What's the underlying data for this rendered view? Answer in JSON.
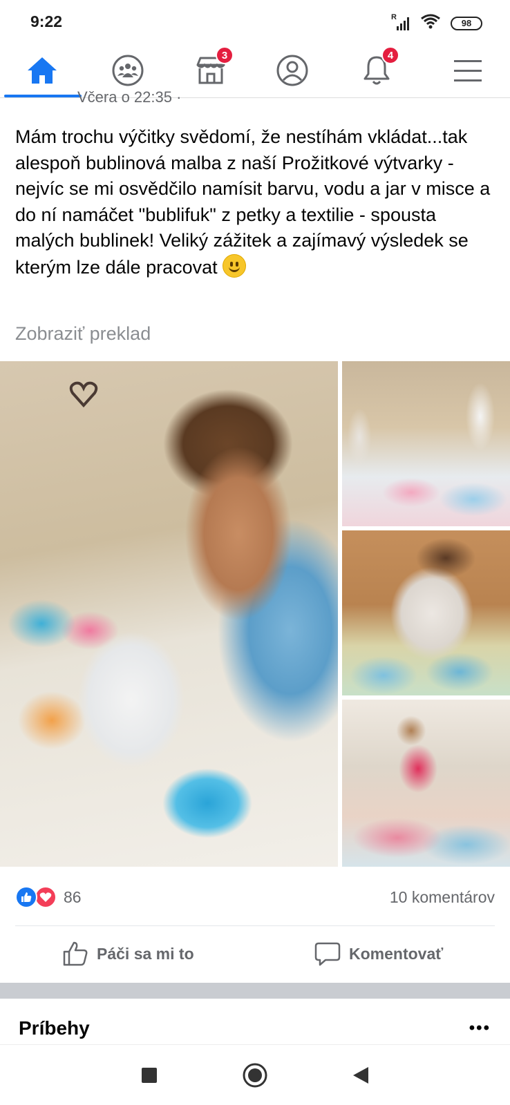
{
  "status_bar": {
    "time": "9:22",
    "signal_label": "R",
    "battery": "98"
  },
  "top_nav": {
    "items": [
      {
        "name": "home",
        "active": true
      },
      {
        "name": "groups",
        "active": false
      },
      {
        "name": "marketplace",
        "badge": "3"
      },
      {
        "name": "profile",
        "active": false
      },
      {
        "name": "notifications",
        "badge": "4"
      },
      {
        "name": "menu",
        "active": false
      }
    ],
    "accent_color": "#1877f2",
    "badge_color": "#e41e3f"
  },
  "post": {
    "meta_partial": "Včera o 22:35 ·",
    "text": "Mám trochu výčitky svědomí, že nestíhám vkládat...tak alespoň bublinová malba z naší Prožitkové výtvarky - nejvíc se mi osvědčilo namísit barvu, vodu a jar v misce a do ní namáčet \"bublifuk\" z petky a textilie - spousta malých bublinek! Veliký zážitek a zajímavý výsledek se kterým lze dále pracovat",
    "translate_label": "Zobraziť preklad",
    "photos": [
      "main-photo",
      "photo-top-right",
      "photo-middle-right",
      "photo-bottom-right"
    ],
    "reaction_count": "86",
    "comment_count": "10 komentárov",
    "like_label": "Páči sa mi to",
    "comment_label": "Komentovať"
  },
  "stories": {
    "title": "Príbehy",
    "more": "•••"
  },
  "android_nav": {
    "buttons": [
      "recent-apps",
      "home",
      "back"
    ]
  }
}
